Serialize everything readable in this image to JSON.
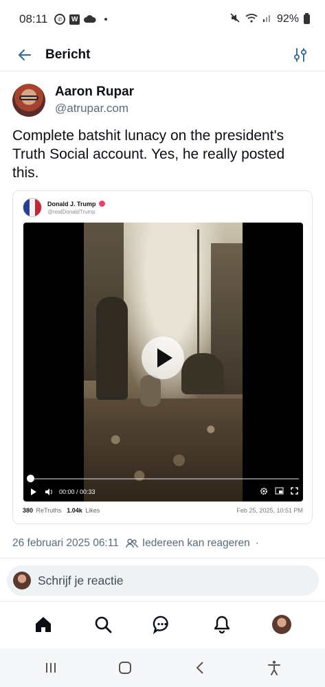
{
  "status_bar": {
    "time": "08:11",
    "battery": "92%"
  },
  "header": {
    "title": "Bericht"
  },
  "post": {
    "author_name": "Aaron Rupar",
    "author_handle": "@atrupar.com",
    "text": "Complete batshit lunacy on the president's Truth Social account. Yes, he really posted this.",
    "embed": {
      "name": "Donald J. Trump",
      "handle": "@realDonaldTrump",
      "video_time": "00:00 / 00:33",
      "retruths_count": "380",
      "retruths_label": "ReTruths",
      "likes_count": "1.04k",
      "likes_label": "Likes",
      "date": "Feb 25, 2025, 10:51 PM",
      "progress": 0
    },
    "timestamp": "26 februari 2025 06:11",
    "reply_permission": "Iedereen kan reageren",
    "separator": "·"
  },
  "reply_box": {
    "placeholder": "Schrijf je reactie"
  },
  "colors": {
    "accent": "#1083fe",
    "text": "#0b0f14",
    "muted": "#5b6b7a",
    "divider": "#e7eaee"
  },
  "icons": {
    "back": "arrow-left-icon",
    "filter": "sliders-icon",
    "home": "home-icon",
    "search": "search-icon",
    "chat": "chat-bubble-icon",
    "notifications": "bell-icon"
  }
}
